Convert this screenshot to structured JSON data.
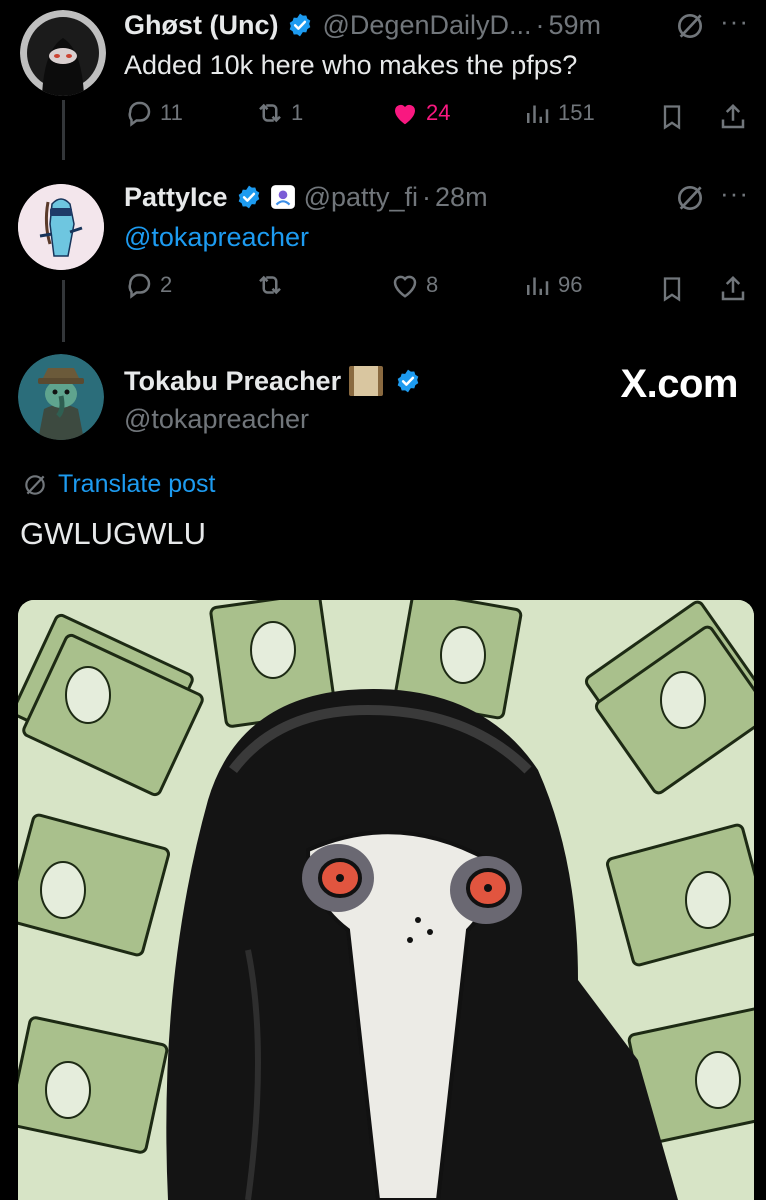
{
  "tweets": [
    {
      "name": "Ghøst (Unc)",
      "handle": "@DegenDailyD...",
      "time": "59m",
      "text": "Added 10k here who makes the pfps?",
      "replies": "11",
      "reposts": "1",
      "likes": "24",
      "views": "151",
      "liked": true
    },
    {
      "name": "PattyIce",
      "handle": "@patty_fi",
      "time": "28m",
      "text": "@tokapreacher",
      "replies": "2",
      "reposts": "",
      "likes": "8",
      "views": "96",
      "liked": false
    }
  ],
  "main": {
    "name": "Tokabu Preacher",
    "handle": "@tokapreacher",
    "brand": "X.com",
    "translate": "Translate post",
    "text": "GWLUGWLU"
  },
  "colors": {
    "accent": "#1d9bf0",
    "like": "#f91880",
    "muted": "#71767b",
    "background": "#000000",
    "media_background": "#d7e4c6"
  },
  "icons": [
    "reply-icon",
    "repost-icon",
    "heart-icon",
    "views-icon",
    "bookmark-icon",
    "share-icon",
    "verified-badge-icon",
    "grok-icon",
    "more-icon",
    "translate-icon",
    "scroll-emoji",
    "rocket-badge-icon"
  ]
}
